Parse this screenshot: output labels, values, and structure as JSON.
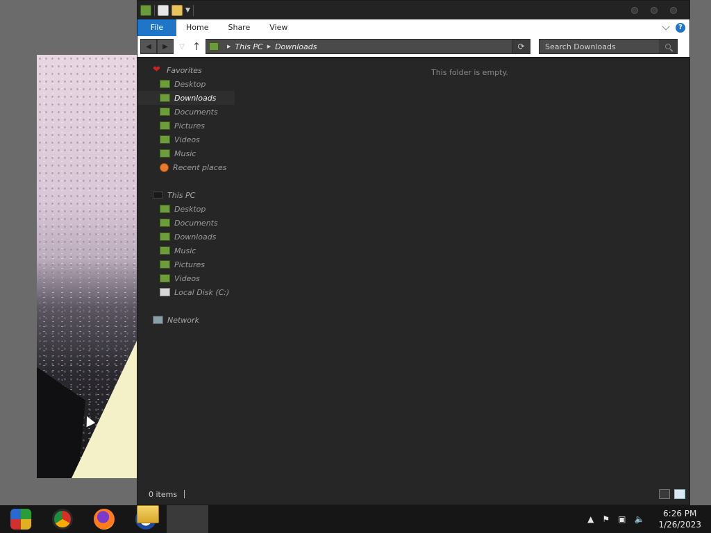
{
  "explorer": {
    "ribbon": {
      "tabs": [
        "File",
        "Home",
        "Share",
        "View"
      ],
      "help_label": "?"
    },
    "address": {
      "crumbs": [
        "This PC",
        "Downloads"
      ],
      "search_placeholder": "Search Downloads"
    },
    "nav": {
      "favorites": {
        "label": "Favorites",
        "items": [
          "Desktop",
          "Downloads",
          "Documents",
          "Pictures",
          "Videos",
          "Music",
          "Recent places"
        ]
      },
      "thispc": {
        "label": "This PC",
        "items": [
          "Desktop",
          "Documents",
          "Downloads",
          "Music",
          "Pictures",
          "Videos",
          "Local Disk (C:)"
        ]
      },
      "network": {
        "label": "Network"
      }
    },
    "content": {
      "empty_message": "This folder is empty."
    },
    "status": {
      "items_count": "0 items"
    }
  },
  "taskbar": {
    "clock": {
      "time": "6:26 PM",
      "date": "1/26/2023"
    },
    "apps": [
      "remote-desktop-icon",
      "chrome-icon",
      "firefox-icon",
      "obama-icon",
      "file-explorer-icon"
    ]
  },
  "colors": {
    "accent": "#1f76c9",
    "window_bg": "#262626",
    "desktop_bg": "#6b6b6b"
  }
}
